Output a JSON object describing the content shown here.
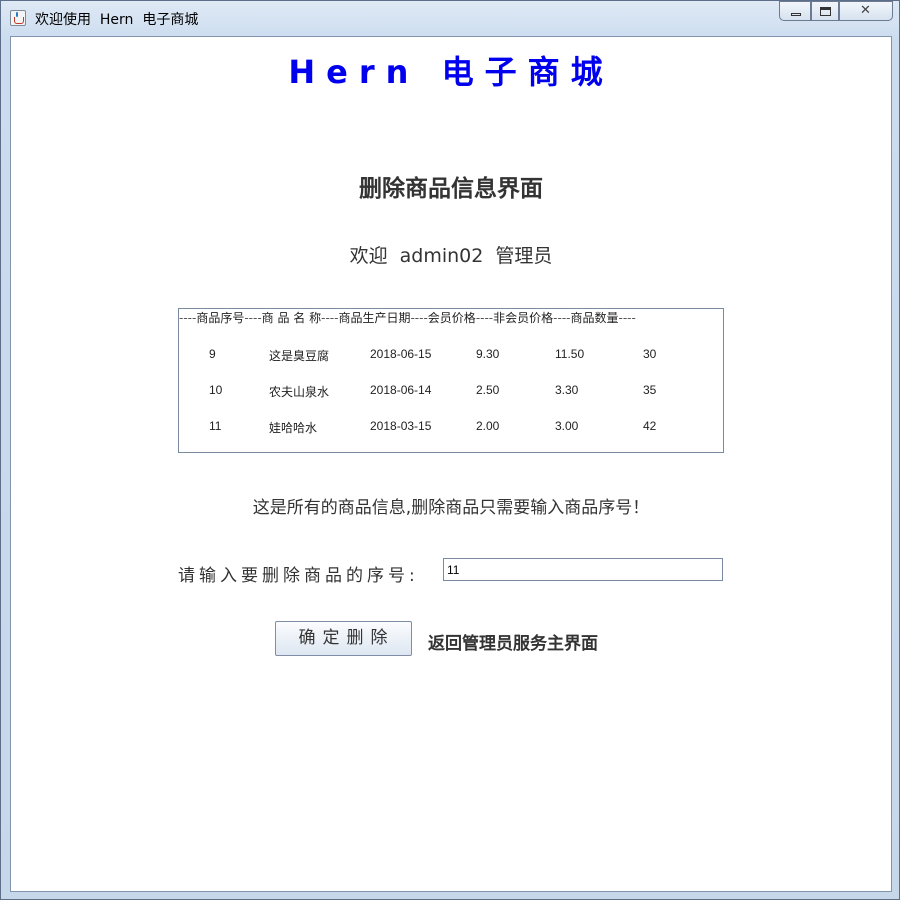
{
  "window": {
    "title": "欢迎使用  Hern  电子商城",
    "close_glyph": "✕"
  },
  "brand": {
    "title": "Hern 电子商城"
  },
  "page": {
    "title": "删除商品信息界面",
    "welcome": "欢迎  admin02  管理员"
  },
  "table": {
    "headers": [
      "商品序号",
      "商 品 名 称",
      "商品生产日期",
      "会员价格",
      "非会员价格",
      "商品数量"
    ],
    "rows": [
      [
        "9",
        "这是臭豆腐",
        "2018-06-15",
        "9.30",
        "11.50",
        "30"
      ],
      [
        "10",
        "农夫山泉水",
        "2018-06-14",
        "2.50",
        "3.30",
        "35"
      ],
      [
        "11",
        "娃哈哈水",
        "2018-03-15",
        "2.00",
        "3.00",
        "42"
      ]
    ]
  },
  "info_text": "这是所有的商品信息,删除商品只需要输入商品序号！",
  "form": {
    "label": "请输入要删除商品的序号:",
    "serial_value": "11"
  },
  "buttons": {
    "confirm_label": "确定删除",
    "back_label": "返回管理员服务主界面"
  },
  "colors": {
    "brand": "#0000ee",
    "text": "#333333",
    "frame": "#cbdcef"
  }
}
